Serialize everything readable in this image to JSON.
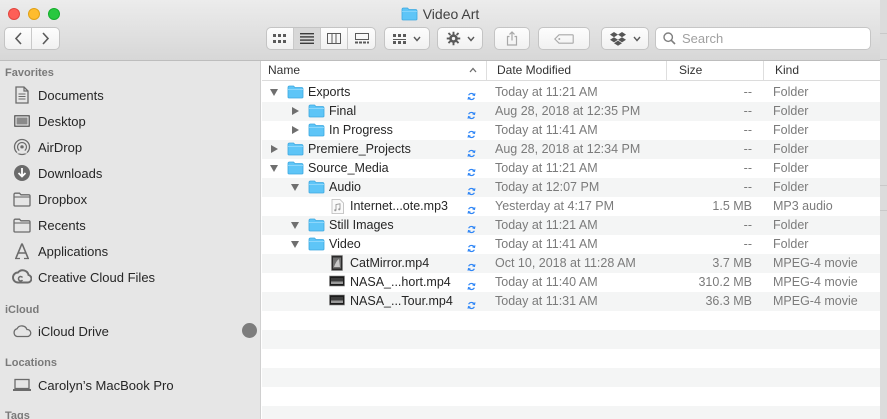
{
  "window": {
    "title": "Video Art"
  },
  "toolbar": {
    "search_placeholder": "Search"
  },
  "sidebar": {
    "favorites_header": "Favorites",
    "favorites": [
      {
        "label": "Documents",
        "icon": "documents-icon"
      },
      {
        "label": "Desktop",
        "icon": "desktop-icon"
      },
      {
        "label": "AirDrop",
        "icon": "airdrop-icon"
      },
      {
        "label": "Downloads",
        "icon": "downloads-icon"
      },
      {
        "label": "Dropbox",
        "icon": "dropbox-folder-icon"
      },
      {
        "label": "Recents",
        "icon": "recents-icon"
      },
      {
        "label": "Applications",
        "icon": "applications-icon"
      },
      {
        "label": "Creative Cloud Files",
        "icon": "creative-cloud-icon"
      }
    ],
    "icloud_header": "iCloud",
    "icloud": [
      {
        "label": "iCloud Drive",
        "icon": "icloud-icon"
      }
    ],
    "locations_header": "Locations",
    "locations": [
      {
        "label": "Carolyn’s MacBook Pro",
        "icon": "laptop-icon"
      }
    ],
    "tags_header": "Tags"
  },
  "columns": {
    "name": "Name",
    "date": "Date Modified",
    "size": "Size",
    "kind": "Kind"
  },
  "files": [
    {
      "name": "Exports",
      "date": "Today at 11:21 AM",
      "size": "--",
      "kind": "Folder",
      "level": 0,
      "type": "folder",
      "disclosure": "open"
    },
    {
      "name": "Final",
      "date": "Aug 28, 2018 at 12:35 PM",
      "size": "--",
      "kind": "Folder",
      "level": 1,
      "type": "folder",
      "disclosure": "closed"
    },
    {
      "name": "In Progress",
      "date": "Today at 11:41 AM",
      "size": "--",
      "kind": "Folder",
      "level": 1,
      "type": "folder",
      "disclosure": "closed"
    },
    {
      "name": "Premiere_Projects",
      "date": "Aug 28, 2018 at 12:34 PM",
      "size": "--",
      "kind": "Folder",
      "level": 0,
      "type": "folder",
      "disclosure": "closed"
    },
    {
      "name": "Source_Media",
      "date": "Today at 11:21 AM",
      "size": "--",
      "kind": "Folder",
      "level": 0,
      "type": "folder",
      "disclosure": "open"
    },
    {
      "name": "Audio",
      "date": "Today at 12:07 PM",
      "size": "--",
      "kind": "Folder",
      "level": 1,
      "type": "folder",
      "disclosure": "open"
    },
    {
      "name": "Internet...ote.mp3",
      "date": "Yesterday at 4:17 PM",
      "size": "1.5 MB",
      "kind": "MP3 audio",
      "level": 2,
      "type": "audio",
      "disclosure": "none"
    },
    {
      "name": "Still Images",
      "date": "Today at 11:21 AM",
      "size": "--",
      "kind": "Folder",
      "level": 1,
      "type": "folder",
      "disclosure": "open"
    },
    {
      "name": "Video",
      "date": "Today at 11:41 AM",
      "size": "--",
      "kind": "Folder",
      "level": 1,
      "type": "folder",
      "disclosure": "open"
    },
    {
      "name": "CatMirror.mp4",
      "date": "Oct 10, 2018 at 11:28 AM",
      "size": "3.7 MB",
      "kind": "MPEG-4 movie",
      "level": 2,
      "type": "video-portrait",
      "disclosure": "none"
    },
    {
      "name": "NASA_...hort.mp4",
      "date": "Today at 11:40 AM",
      "size": "310.2 MB",
      "kind": "MPEG-4 movie",
      "level": 2,
      "type": "video",
      "disclosure": "none"
    },
    {
      "name": "NASA_...Tour.mp4",
      "date": "Today at 11:31 AM",
      "size": "36.3 MB",
      "kind": "MPEG-4 movie",
      "level": 2,
      "type": "video",
      "disclosure": "none"
    }
  ],
  "colors": {
    "folder": "#5ec5f7",
    "sync": "#2f86f6",
    "accent": "#2f86f6"
  }
}
